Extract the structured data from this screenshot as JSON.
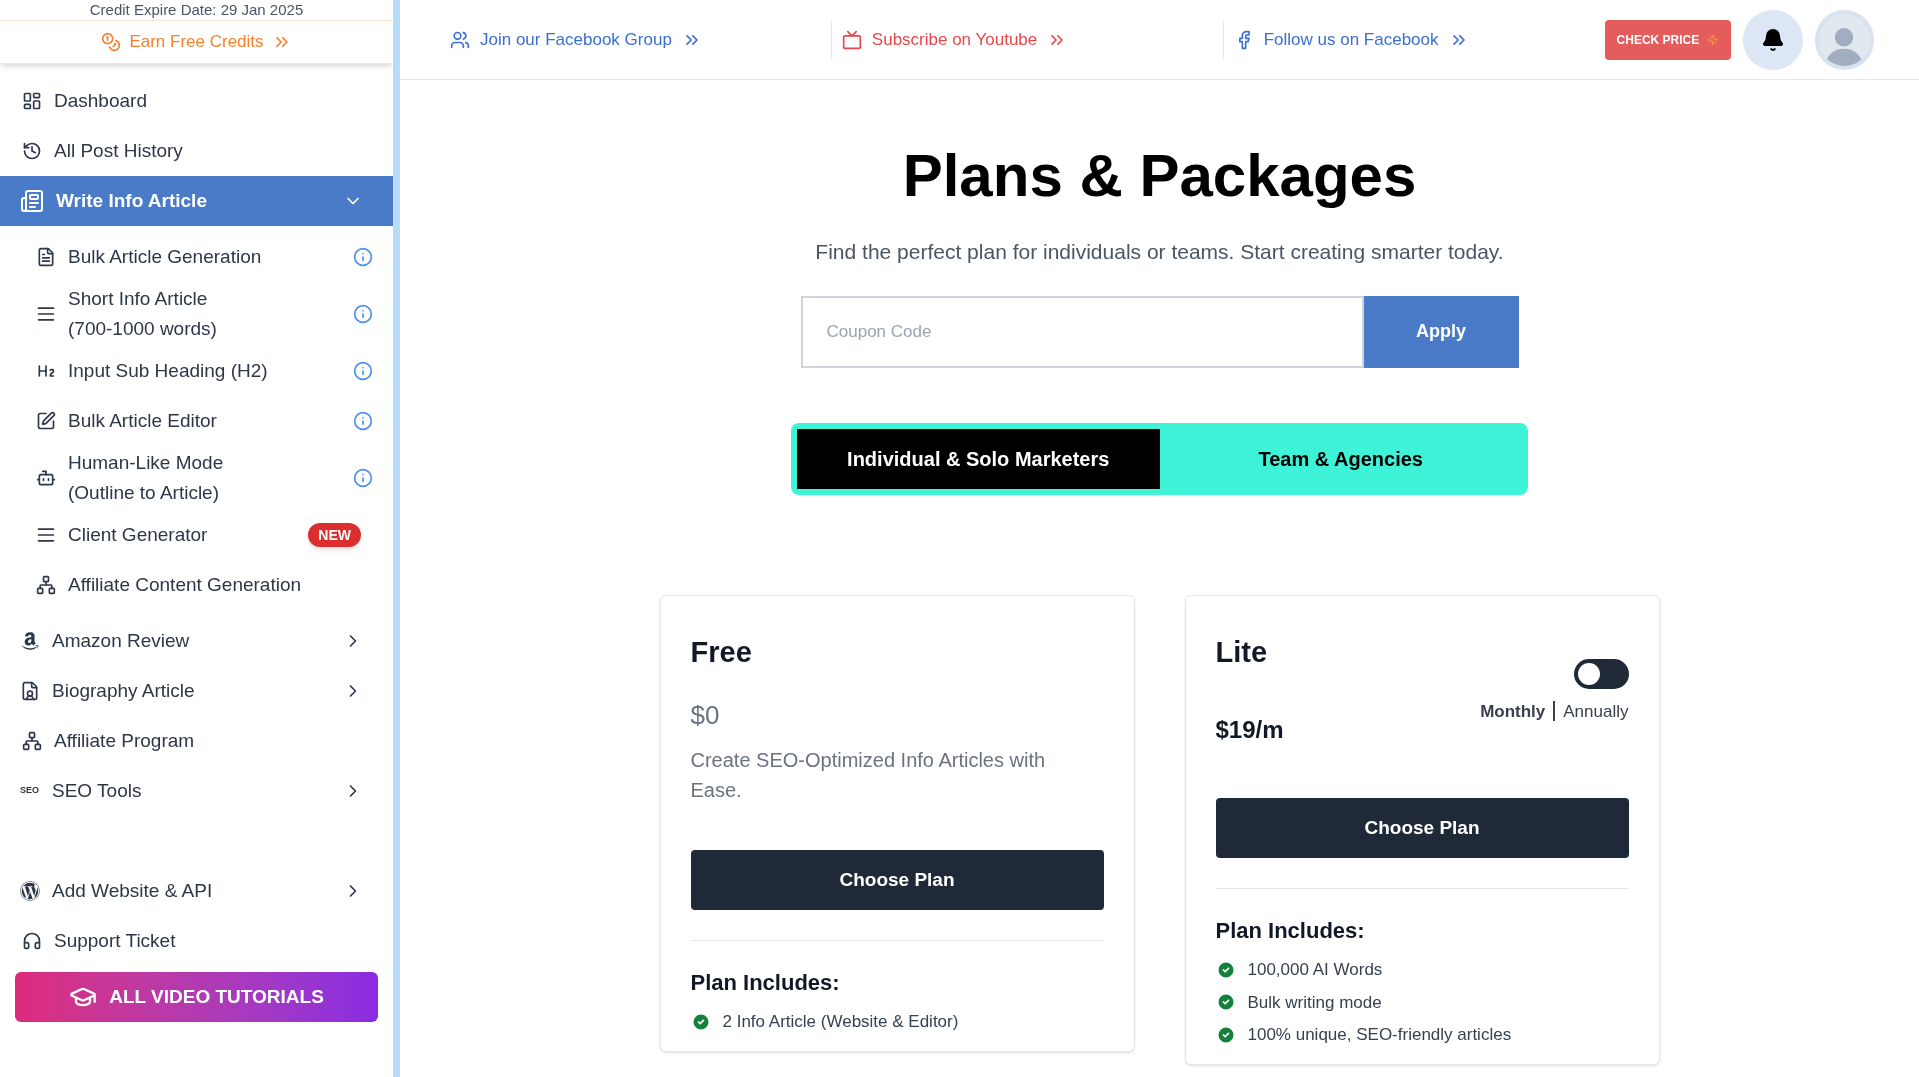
{
  "sidebar": {
    "credit_expire": "Credit Expire Date: 29 Jan 2025",
    "earn_credits": "Earn Free Credits",
    "items": [
      {
        "kind": "link",
        "label": "Dashboard"
      },
      {
        "kind": "link",
        "label": "All Post History"
      },
      {
        "kind": "group",
        "label": "Write Info Article",
        "expanded": true,
        "selected": true,
        "children": [
          {
            "label": "Bulk Article Generation",
            "info": true
          },
          {
            "label": "Short Info Article\n(700-1000 words)",
            "info": true
          },
          {
            "label": "Input Sub Heading (H2)",
            "info": true
          },
          {
            "label": "Bulk Article Editor",
            "info": true
          },
          {
            "label": "Human-Like Mode\n(Outline to Article)",
            "info": true
          },
          {
            "label": "Client Generator",
            "info": false,
            "badge": "NEW"
          },
          {
            "label": "Affiliate Content Generation",
            "info": false
          }
        ]
      },
      {
        "kind": "group",
        "label": "Amazon Review",
        "expanded": false,
        "selected": false
      },
      {
        "kind": "group",
        "label": "Biography Article",
        "expanded": false,
        "selected": false
      },
      {
        "kind": "link",
        "label": "Affiliate Program"
      },
      {
        "kind": "group",
        "icon_text": "SEO",
        "label": "SEO Tools",
        "expanded": false,
        "selected": false
      },
      {
        "kind": "spacer"
      },
      {
        "kind": "group",
        "label": "Add Website & API",
        "expanded": false,
        "selected": false
      },
      {
        "kind": "link",
        "label": "Support Ticket"
      }
    ],
    "tutorials_button": "ALL VIDEO TUTORIALS"
  },
  "topbar": {
    "links": [
      {
        "label": "Join our Facebook Group",
        "color": "#3b6fd1"
      },
      {
        "label": "Subscribe on Youtube",
        "color": "#e8484b"
      },
      {
        "label": "Follow us on Facebook",
        "color": "#3b6fd1"
      }
    ],
    "check_price": "CHECK PRICE"
  },
  "main": {
    "title": "Plans & Packages",
    "subtitle": "Find the perfect plan for individuals or teams. Start creating smarter today.",
    "coupon": {
      "placeholder": "Coupon Code",
      "button": "Apply"
    },
    "tabs": [
      {
        "label": "Individual & Solo Marketers",
        "selected": true
      },
      {
        "label": "Team & Agencies",
        "selected": false
      }
    ],
    "plans": [
      {
        "kind": "free",
        "name": "Free",
        "price": "$0",
        "description": "Create SEO-Optimized Info Articles with Ease.",
        "button": "Choose Plan",
        "includes_title": "Plan Includes:",
        "features": [
          "2 Info Article (Website & Editor)"
        ]
      },
      {
        "kind": "paid",
        "name": "Lite",
        "billing": {
          "annually": false,
          "monthly_label": "Monthly",
          "annually_label": "Annually"
        },
        "price": "$19/m",
        "button": "Choose Plan",
        "includes_title": "Plan Includes:",
        "features": [
          "100,000 AI Words",
          "Bulk writing mode",
          "100% unique, SEO-friendly articles"
        ]
      }
    ]
  }
}
